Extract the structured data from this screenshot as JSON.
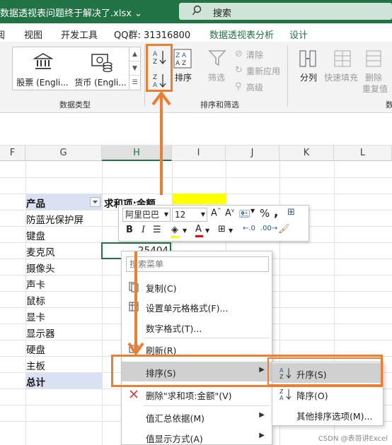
{
  "titlebar": {
    "filename": "数据透视表问题终于解决了.xlsx",
    "search_placeholder": "搜索"
  },
  "tabs": [
    "阅",
    "视图",
    "开发工具",
    "QQ群: 31316800",
    "数据透视表分析",
    "设计"
  ],
  "ribbon": {
    "data_types": {
      "items": [
        "股票 (Engli...",
        "货币 (Engli..."
      ],
      "group_label": "数据类型"
    },
    "sort_filter": {
      "sort_button": "排序",
      "filter_button": "筛选",
      "clear": "清除",
      "reapply": "重新应用",
      "advanced": "高级",
      "group_label": "排序和筛选"
    },
    "data_tools": {
      "text_to_columns": "分列",
      "flash_fill": "快速填充",
      "remove_dup_1": "删除",
      "remove_dup_2": "重复值",
      "partial": "数"
    }
  },
  "columns": [
    "F",
    "G",
    "H",
    "I",
    "J",
    "K",
    "L"
  ],
  "pivot": {
    "header_product": "产品",
    "header_sum": "求和项:金额",
    "rows": [
      "防蓝光保护屏",
      "键盘",
      "麦克风",
      "摄像头",
      "声卡",
      "鼠标",
      "显卡",
      "显示器",
      "硬盘",
      "主板"
    ],
    "total_label": "总计",
    "active_value": "25404"
  },
  "mini_toolbar": {
    "font": "阿里巴巴",
    "size": "12"
  },
  "context_menu": {
    "search_placeholder": "搜索菜单",
    "copy": "复制(C)",
    "format_cells": "设置单元格格式(F)...",
    "number_format": "数字格式(T)...",
    "refresh": "刷新(R)",
    "sort": "排序(S)",
    "delete_field": "删除\"求和项:金额\"(V)",
    "summarize_by": "值汇总依据(M)",
    "show_values_as": "值显示方式(A)"
  },
  "sort_submenu": {
    "ascending": "升序(S)",
    "descending": "降序(O)",
    "more": "其他排序选项(M)..."
  },
  "watermark": "CSDN @表哥讲Excel",
  "colors": {
    "excel_green": "#217346",
    "accent_orange": "#ed7d31",
    "pivot_blue": "#d9e1f2"
  }
}
